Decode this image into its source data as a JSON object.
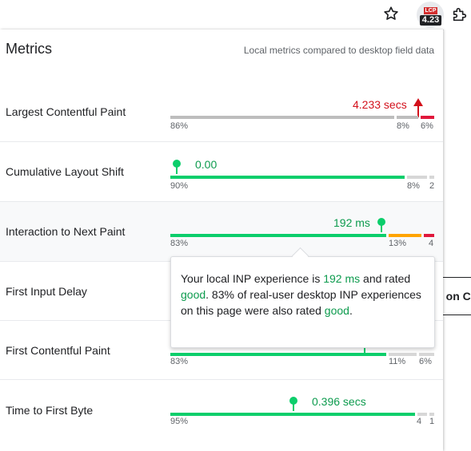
{
  "toolbar": {
    "ext_badge_label": "LCP",
    "ext_badge_value": "4.23"
  },
  "panel": {
    "title": "Metrics",
    "subtitle": "Local metrics compared to desktop field data"
  },
  "metrics": [
    {
      "name": "Largest Contentful Paint",
      "value": "4.233 secs",
      "pct_good": "86%",
      "pct_ni": "8%",
      "pct_poor": "6%"
    },
    {
      "name": "Cumulative Layout Shift",
      "value": "0.00",
      "pct_good": "90%",
      "pct_ni": "8%",
      "pct_poor": "2"
    },
    {
      "name": "Interaction to Next Paint",
      "value": "192 ms",
      "pct_good": "83%",
      "pct_ni": "13%",
      "pct_poor": "4"
    },
    {
      "name": "First Input Delay"
    },
    {
      "name": "First Contentful Paint",
      "pct_good": "83%",
      "pct_ni": "11%",
      "pct_poor": "6%"
    },
    {
      "name": "Time to First Byte",
      "value": "0.396 secs",
      "pct_good": "95%",
      "pct_ni": "4",
      "pct_poor": "1"
    }
  ],
  "tooltip": {
    "t1": "Your local INP experience is ",
    "value": "192 ms",
    "t2": " and rated ",
    "rating": "good",
    "t3": ". 83% of real-user desktop INP experiences on this page were also rated ",
    "rating2": "good",
    "t4": "."
  },
  "page": {
    "snippet": "s on C"
  },
  "colors": {
    "good": "#0cce6b",
    "needs_improvement": "#ffa400",
    "poor": "#ff4e42"
  }
}
